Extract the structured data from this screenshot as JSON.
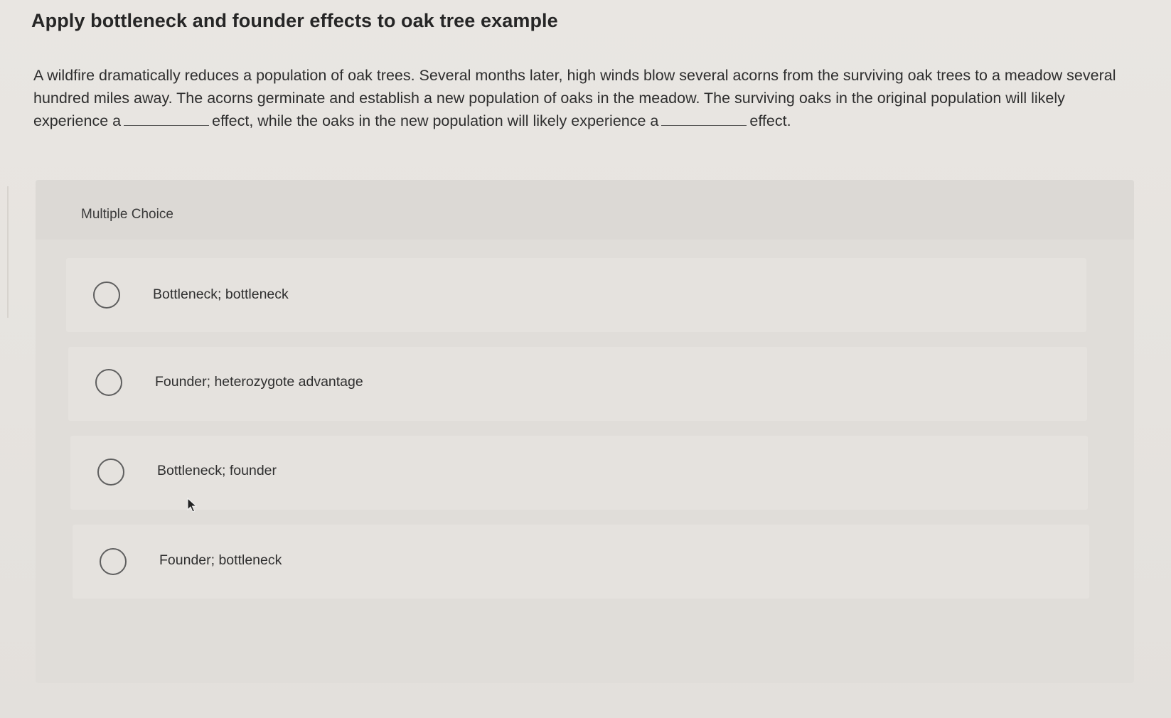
{
  "question": {
    "title": "Apply bottleneck and founder effects to oak tree example",
    "text_part1": "A wildfire dramatically reduces a population of oak trees. Several months later, high winds blow several acorns from the surviving oak trees to a meadow several hundred miles away. The acorns germinate and establish a new population of oaks in the meadow. The surviving oaks in the original population will likely experience a",
    "text_part2": "effect, while the oaks in the new population will likely experience a",
    "text_part3": "effect."
  },
  "multiple_choice": {
    "label": "Multiple Choice",
    "options": [
      {
        "label": "Bottleneck; bottleneck",
        "selected": false
      },
      {
        "label": "Founder; heterozygote advantage",
        "selected": false
      },
      {
        "label": "Bottleneck; founder",
        "selected": false
      },
      {
        "label": "Founder; bottleneck",
        "selected": false
      }
    ]
  },
  "icons": {
    "radio": "radio-circle-icon",
    "cursor": "mouse-pointer-icon"
  },
  "colors": {
    "background": "#e7e4e0",
    "panel": "#e0ddd9",
    "option_bg": "#e5e2de",
    "text": "#2b2b2b",
    "radio_border": "#5f5f5f"
  }
}
